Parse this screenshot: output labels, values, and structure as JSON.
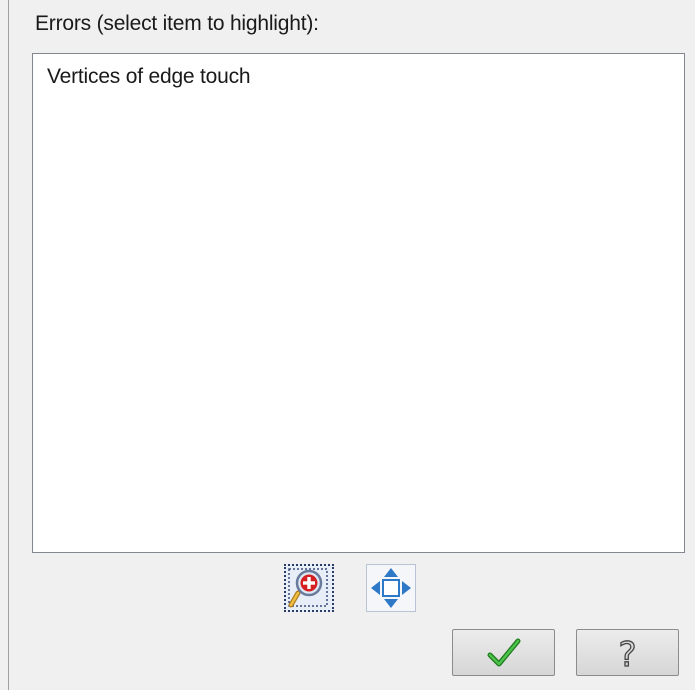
{
  "dialog": {
    "errors_label": "Errors (select item to highlight):",
    "errors_list": [
      {
        "label": "Vertices of edge touch"
      }
    ]
  },
  "toolbar": {
    "zoom_icon": "zoom-to-selection-icon",
    "pan_icon": "pan-to-selection-icon"
  },
  "buttons": {
    "ok_icon": "checkmark-icon",
    "help_icon": "question-mark-icon"
  },
  "colors": {
    "window_bg": "#f0f0f0",
    "listbox_bg": "#ffffff",
    "checkmark": "#2e9e2a",
    "pan_arrows": "#2e78c8",
    "zoom_plus": "#d42020"
  }
}
